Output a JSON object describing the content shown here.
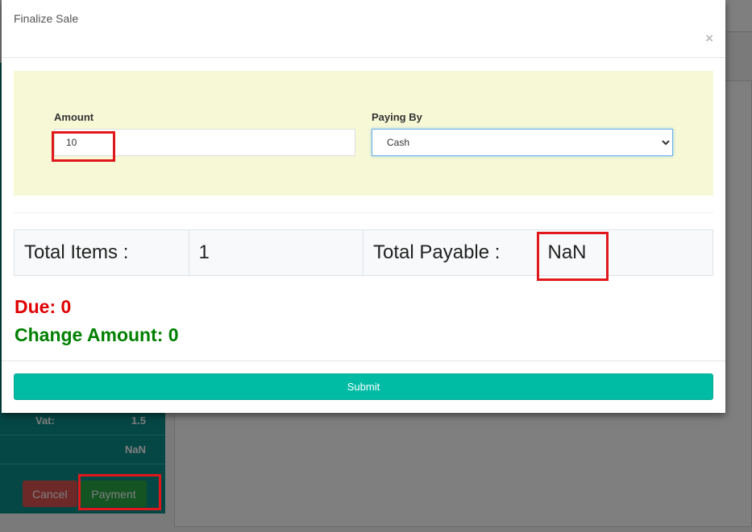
{
  "background": {
    "summary_rows": [
      {
        "label": "Vat:",
        "value": "1.5"
      },
      {
        "label": "",
        "value": "NaN"
      }
    ],
    "cancel_label": "Cancel",
    "payment_label": "Payment"
  },
  "modal": {
    "title": "Finalize Sale",
    "close_label": "×",
    "amount": {
      "label": "Amount",
      "value": "10"
    },
    "paying_by": {
      "label": "Paying By",
      "selected": "Cash"
    },
    "totals": {
      "items_label": "Total Items :",
      "items_value": "1",
      "payable_label": "Total Payable :",
      "payable_value": "NaN"
    },
    "due_text": "Due: 0",
    "change_text": "Change Amount: 0",
    "submit_label": "Submit"
  },
  "colors": {
    "accent": "#00bca5",
    "due": "#e00000",
    "change": "#008000",
    "highlight": "#e0181b"
  }
}
